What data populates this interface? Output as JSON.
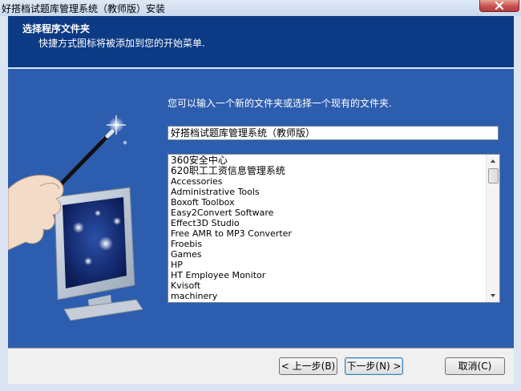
{
  "window": {
    "title": "好搭档试题库管理系统（教师版）安装"
  },
  "header": {
    "title": "选择程序文件夹",
    "subtitle": "快捷方式图标将被添加到您的开始菜单."
  },
  "main": {
    "instruction": "您可以输入一个新的文件夹或选择一个现有的文件夹.",
    "folder_input_value": "好搭档试题库管理系统（教师版）",
    "folder_list": [
      "360安全中心",
      "620职工工资信息管理系统",
      "Accessories",
      "Administrative Tools",
      "Boxoft Toolbox",
      "Easy2Convert Software",
      "Effect3D Studio",
      "Free AMR to MP3 Converter",
      "Froebis",
      "Games",
      "HP",
      "HT Employee Monitor",
      "Kvisoft",
      "machinery"
    ]
  },
  "buttons": {
    "back": "< 上一步(B)",
    "next": "下一步(N) >",
    "cancel": "取消(C)"
  },
  "icons": {
    "close": "close-icon",
    "scroll_up": "scroll-up-icon",
    "scroll_down": "scroll-down-icon",
    "illustration": "magic-wand-computer-illustration"
  },
  "colors": {
    "header_bg": "#0c3a84",
    "panel_bg": "#2d5dae",
    "close_button": "#c75050"
  }
}
